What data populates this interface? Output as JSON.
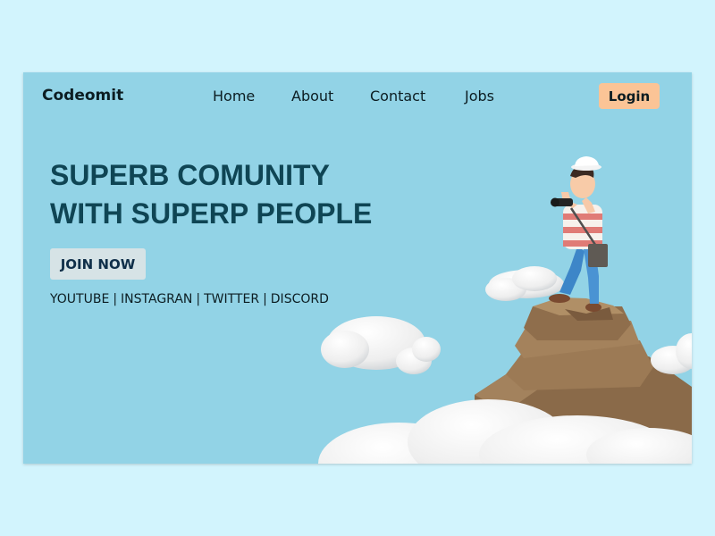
{
  "brand": {
    "name": "Codeomit"
  },
  "nav": {
    "items": [
      "Home",
      "About",
      "Contact",
      "Jobs"
    ]
  },
  "header": {
    "login_label": "Login"
  },
  "hero": {
    "title_line1": "SUPERB COMUNITY",
    "title_line2": "WITH SUPERP PEOPLE",
    "cta_label": "JOIN NOW"
  },
  "social": {
    "links": [
      "YOUTUBE",
      "INSTAGRAN",
      "TWITTER",
      "DISCORD"
    ],
    "separator": "|"
  },
  "colors": {
    "page_background": "#d2f4fd",
    "card_background": "#92d3e6",
    "headline": "#0f4554",
    "login_button": "#fbc496",
    "join_button": "#d6e3e6"
  }
}
